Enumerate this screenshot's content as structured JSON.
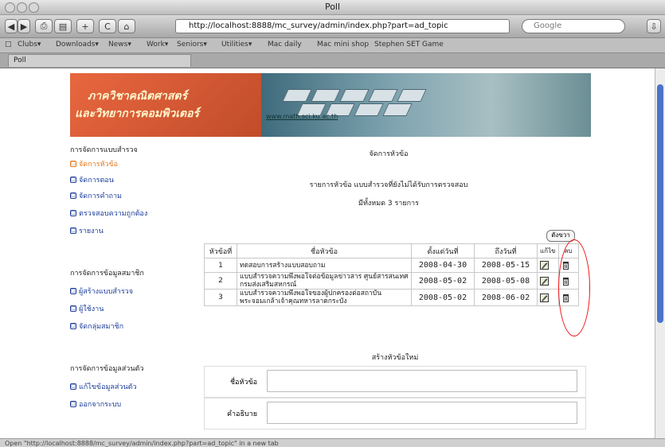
{
  "window": {
    "title": "Poll"
  },
  "toolbar": {
    "url": "http://localhost:8888/mc_survey/admin/index.php?part=ad_topic",
    "search_placeholder": "Google"
  },
  "bookmarks": [
    "Clubs▾",
    "Downloads▾",
    "News▾",
    "Work▾",
    "Seniors▾",
    "Utilities▾",
    "Mac daily",
    "Mac mini shop",
    "Stephen SET Game"
  ],
  "tab": {
    "label": "Poll"
  },
  "banner": {
    "line1": "ภาควิชาคณิตศาสตร์",
    "line2": "และวิทยาการคอมพิวเตอร์",
    "link": "www.math.sci.ku.ac.th"
  },
  "sidebar": {
    "section1": "การจัดการแบบสำรวจ",
    "items1": [
      "จัดการหัวข้อ",
      "จัดการตอน",
      "จัดการคำถาม",
      "ตรวจสอบความถูกต้อง",
      "รายงาน"
    ],
    "section2": "การจัดการข้อมูลสมาชิก",
    "items2": [
      "ผู้สร้างแบบสำรวจ",
      "ผู้ใช้งาน",
      "จัดกลุ่มสมาชิก"
    ],
    "section3": "การจัดการข้อมูลส่วนตัว",
    "items3": [
      "แก้ไขข้อมูลส่วนตัว",
      "ออกจากระบบ"
    ]
  },
  "main": {
    "heading": "จัดการหัวข้อ",
    "subheading": "รายการหัวข้อ แบบสำรวจที่ยังไม่ได้รับการตรวจสอบ",
    "count_text": "มีทั้งหมด 3 รายการ",
    "add_button": "ดังขวา"
  },
  "table": {
    "headers": [
      "หัวข้อที่",
      "ชื่อหัวข้อ",
      "ตั้งแต่วันที่",
      "ถึงวันที่",
      "แก้ไข",
      "ลบ"
    ],
    "rows": [
      {
        "no": "1",
        "subject": "ทดสอบการสร้างแบบสอบถาม",
        "start": "2008-04-30",
        "end": "2008-05-15"
      },
      {
        "no": "2",
        "subject": "แบบสำรวจความพึงพอใจต่อข้อมูลข่าวสาร ศูนย์สารสนเทศ กรมส่งเสริมสหกรณ์",
        "start": "2008-05-02",
        "end": "2008-05-08"
      },
      {
        "no": "3",
        "subject": "แบบสำรวจความพึงพอใจของผู้ปกครองต่อสถาบันพระจอมเกล้าเจ้าคุณทหารลาดกระบัง",
        "start": "2008-05-02",
        "end": "2008-06-02"
      }
    ]
  },
  "form": {
    "title": "สร้างหัวข้อใหม่",
    "label_name": "ชื่อหัวข้อ",
    "label_desc": "คำอธิบาย"
  },
  "statusbar": {
    "text": "Open \"http://localhost:8888/mc_survey/admin/index.php?part=ad_topic\" in a new tab"
  }
}
